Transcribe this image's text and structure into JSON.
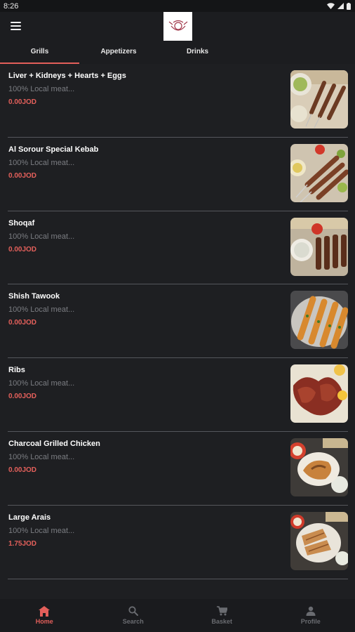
{
  "status": {
    "time": "8:26"
  },
  "colors": {
    "accent": "#e35f5a",
    "background": "#1e1f22",
    "price": "#e4605b"
  },
  "tabs": [
    {
      "label": "Grills",
      "active": true
    },
    {
      "label": "Appetizers",
      "active": false
    },
    {
      "label": "Drinks",
      "active": false
    }
  ],
  "items": [
    {
      "name": "Liver + Kidneys + Hearts + Eggs",
      "desc": "100% Local meat...",
      "price": "0.00JOD",
      "image": "kebab-skewers-platter"
    },
    {
      "name": "Al Sorour Special Kebab",
      "desc": "100% Local meat...",
      "price": "0.00JOD",
      "image": "kebab-with-tomatoes"
    },
    {
      "name": "Shoqaf",
      "desc": "100% Local meat...",
      "price": "0.00JOD",
      "image": "meat-cubes-skewers"
    },
    {
      "name": "Shish Tawook",
      "desc": "100% Local meat...",
      "price": "0.00JOD",
      "image": "chicken-skewers"
    },
    {
      "name": "Ribs",
      "desc": "100% Local meat...",
      "price": "0.00JOD",
      "image": "grilled-ribs"
    },
    {
      "name": "Charcoal Grilled Chicken",
      "desc": "100% Local meat...",
      "price": "0.00JOD",
      "image": "grilled-chicken-plate"
    },
    {
      "name": "Large Arais",
      "desc": "100% Local meat...",
      "price": "1.75JOD",
      "image": "arais-bread"
    }
  ],
  "nav": [
    {
      "label": "Home",
      "icon": "home-icon",
      "active": true
    },
    {
      "label": "Search",
      "icon": "search-icon",
      "active": false
    },
    {
      "label": "Basket",
      "icon": "cart-icon",
      "active": false
    },
    {
      "label": "Profile",
      "icon": "person-icon",
      "active": false
    }
  ]
}
